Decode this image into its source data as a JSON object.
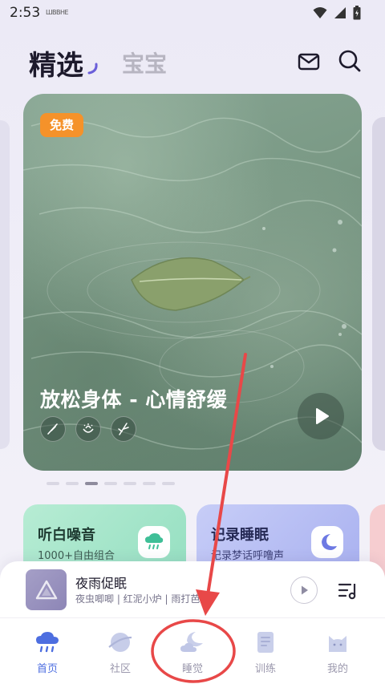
{
  "status_bar": {
    "time": "2:53",
    "carrier": "ШВВНЕ"
  },
  "header": {
    "tab_active": "精选",
    "tab_inactive": "宝宝"
  },
  "hero": {
    "badge": "免费",
    "title": "放松身体 - 心情舒缓"
  },
  "pager": {
    "count": 7,
    "active_index": 2
  },
  "features": {
    "noise": {
      "title": "听白噪音",
      "subtitle": "1000+自由组合"
    },
    "sleep": {
      "title": "记录睡眠",
      "subtitle": "记录梦话呼噜声"
    }
  },
  "mini_player": {
    "title": "夜雨促眠",
    "subtitle": "夜虫唧唧 | 红泥小炉 | 雨打芭蕉"
  },
  "bottom_nav": {
    "items": [
      {
        "label": "首页",
        "icon": "rain-cloud-icon",
        "active": true
      },
      {
        "label": "社区",
        "icon": "planet-icon",
        "active": false
      },
      {
        "label": "睡觉",
        "icon": "moon-cloud-icon",
        "active": false
      },
      {
        "label": "训练",
        "icon": "notebook-icon",
        "active": false
      },
      {
        "label": "我的",
        "icon": "cat-icon",
        "active": false
      }
    ]
  },
  "colors": {
    "accent": "#4d6ee0",
    "badge": "#f5922a",
    "annotation": "#e84848"
  }
}
